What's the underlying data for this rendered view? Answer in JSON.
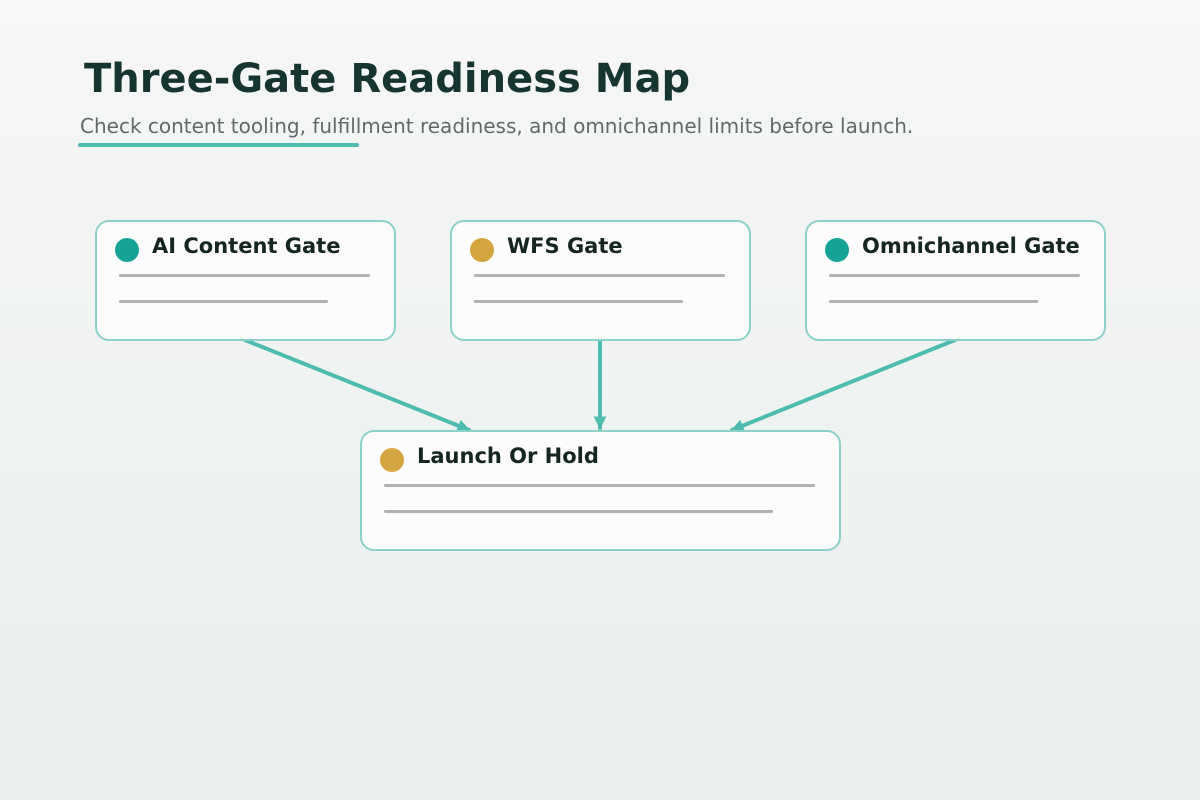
{
  "header": {
    "title": "Three-Gate Readiness Map",
    "subtitle": "Check content tooling, fulfillment readiness, and omnichannel limits before launch."
  },
  "colors": {
    "teal": "#14a394",
    "gold": "#d4a53e",
    "connector": "#4dbbaf",
    "node_border": "#8dd0c8"
  },
  "gates": [
    {
      "label": "AI Content Gate",
      "status_color": "#14a394"
    },
    {
      "label": "WFS Gate",
      "status_color": "#d4a53e"
    },
    {
      "label": "Omnichannel Gate",
      "status_color": "#14a394"
    }
  ],
  "decision": {
    "label": "Launch Or Hold",
    "status_color": "#d4a53e"
  },
  "edges": [
    {
      "from": "AI Content Gate",
      "to": "Launch Or Hold"
    },
    {
      "from": "WFS Gate",
      "to": "Launch Or Hold"
    },
    {
      "from": "Omnichannel Gate",
      "to": "Launch Or Hold"
    }
  ]
}
